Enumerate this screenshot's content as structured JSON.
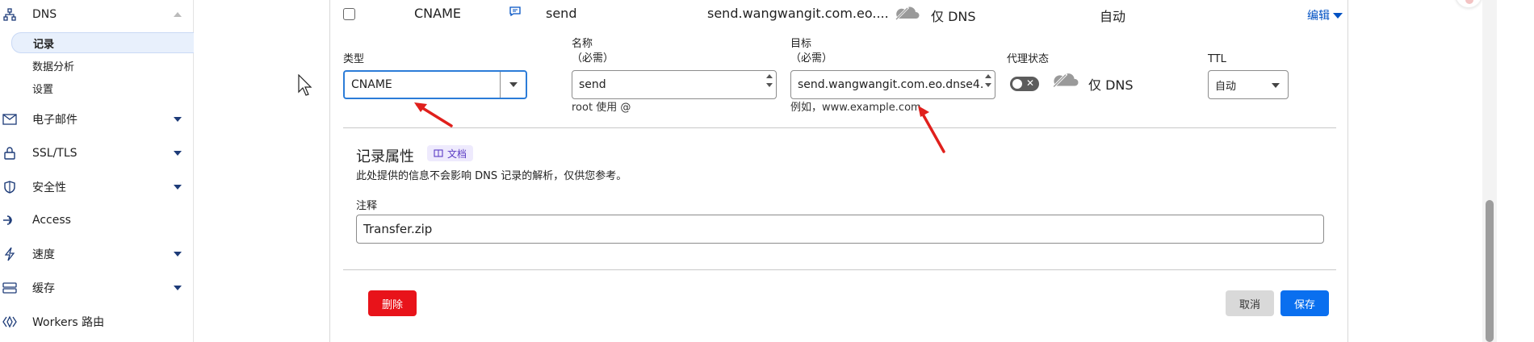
{
  "sidebar": {
    "dns": {
      "label": "DNS",
      "icon": "sitemap-icon"
    },
    "sub": [
      {
        "label": "记录",
        "active": true
      },
      {
        "label": "数据分析"
      },
      {
        "label": "设置"
      }
    ],
    "items": [
      {
        "label": "电子邮件",
        "icon": "mail-icon"
      },
      {
        "label": "SSL/TLS",
        "icon": "lock-icon"
      },
      {
        "label": "安全性",
        "icon": "shield-icon"
      },
      {
        "label": "Access",
        "icon": "access-icon"
      },
      {
        "label": "速度",
        "icon": "bolt-icon"
      },
      {
        "label": "缓存",
        "icon": "cache-icon"
      },
      {
        "label": "Workers 路由",
        "icon": "workers-icon"
      }
    ]
  },
  "record_row": {
    "type": "CNAME",
    "name": "send",
    "target": "send.wangwangit.com.eo....",
    "proxy": "仅 DNS",
    "ttl": "自动",
    "edit_label": "编辑"
  },
  "form": {
    "type_label": "类型",
    "type_value": "CNAME",
    "name_label": "名称",
    "name_required": "（必需）",
    "name_value": "send",
    "name_hint": "root 使用 @",
    "target_label": "目标",
    "target_required": "（必需）",
    "target_value": "send.wangwangit.com.eo.dnse4.",
    "target_hint": "例如，www.example.com",
    "proxy_label": "代理状态",
    "proxy_value": "仅 DNS",
    "ttl_label": "TTL",
    "ttl_value": "自动"
  },
  "record_attrs": {
    "title": "记录属性",
    "doc_badge": "文档",
    "description": "此处提供的信息不会影响 DNS 记录的解析，仅供您参考。",
    "comment_label": "注释",
    "comment_value": "Transfer.zip"
  },
  "actions": {
    "delete": "删除",
    "cancel": "取消",
    "save": "保存"
  },
  "colors": {
    "accent": "#0051c3",
    "save": "#0a6fef",
    "delete": "#e8131a",
    "annotation_arrow": "#e0201c"
  }
}
